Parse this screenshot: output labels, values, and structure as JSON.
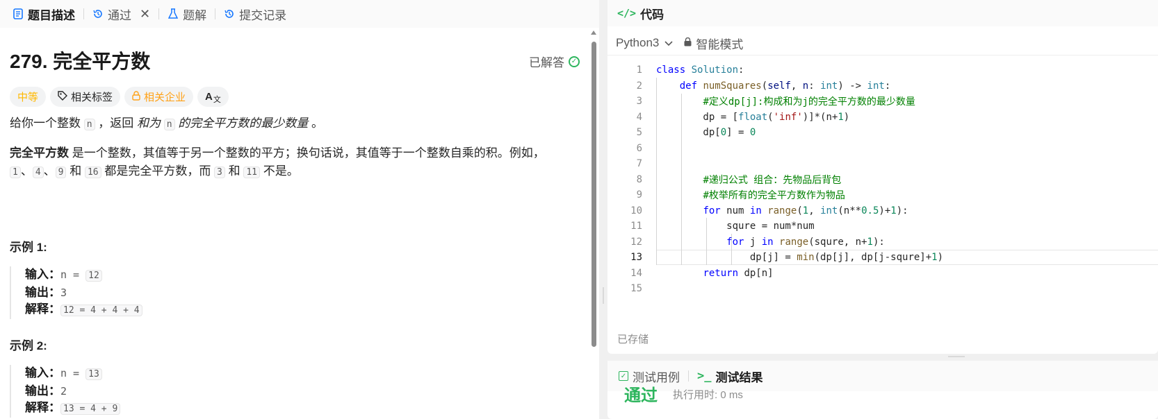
{
  "left_tabs": [
    {
      "label": "题目描述",
      "icon": "doc-icon",
      "active": true
    },
    {
      "label": "通过",
      "icon": "history-icon",
      "active": false
    },
    {
      "label": "题解",
      "icon": "flask-icon",
      "active": false
    },
    {
      "label": "提交记录",
      "icon": "history-icon",
      "active": false
    }
  ],
  "problem": {
    "title": "279. 完全平方数",
    "status": "已解答",
    "tags": {
      "difficulty": "中等",
      "related_tags": "相关标签",
      "related_companies": "相关企业",
      "translate": "A"
    },
    "para1": {
      "a": "给你一个整数 ",
      "n1": "n",
      "b": " ，返回 ",
      "c": "和为 ",
      "n2": "n",
      "d": " 的完全平方数的最少数量",
      "e": " 。"
    },
    "para2": {
      "bold": "完全平方数",
      "text1": " 是一个整数，其值等于另一个整数的平方；换句话说，其值等于一个整数自乘的积。例如，",
      "c1": "1",
      "s1": "、",
      "c2": "4",
      "s2": "、",
      "c3": "9",
      "s3": " 和 ",
      "c4": "16",
      "s4": " 都是完全平方数，而 ",
      "c5": "3",
      "s5": " 和 ",
      "c6": "11",
      "s6": " 不是。"
    },
    "examples": [
      {
        "title": "示例 1:",
        "input_label": "输入：",
        "input": "n = ",
        "input_val": "12",
        "output_label": "输出：",
        "output": "3",
        "explain_label": "解释：",
        "explain": "12 = 4 + 4 + 4"
      },
      {
        "title": "示例 2:",
        "input_label": "输入：",
        "input": "n = ",
        "input_val": "13",
        "output_label": "输出：",
        "output": "2",
        "explain_label": "解释：",
        "explain": "13 = 4 + 9"
      }
    ]
  },
  "code_panel": {
    "title": "代码",
    "icon": "code-icon",
    "language": "Python3",
    "mode": "智能模式",
    "saved": "已存储",
    "active_line": "13"
  },
  "test_panel": {
    "tab1": "测试用例",
    "tab2": "测试结果",
    "result": "通过",
    "runtime": "执行用时: 0 ms"
  },
  "colors": {
    "accent_green": "#2db55d",
    "difficulty_medium": "#ffb800",
    "company": "#ffa116"
  }
}
